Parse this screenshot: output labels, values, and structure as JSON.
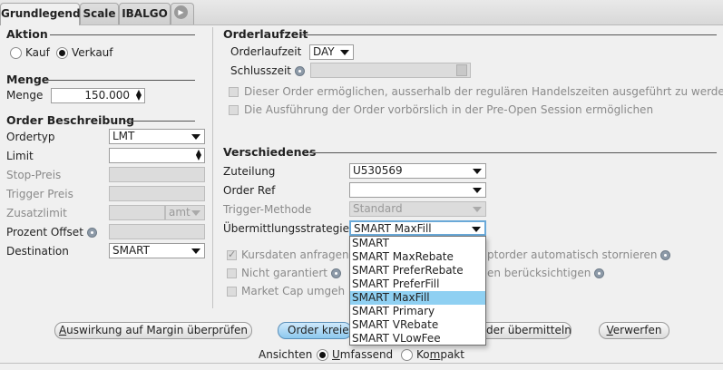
{
  "tabs": [
    {
      "label": "Grundlegend",
      "active": true
    },
    {
      "label": "Scale",
      "active": false
    },
    {
      "label": "IBALGO",
      "active": false
    }
  ],
  "tab_more_icon": "play-circle-icon",
  "aktion": {
    "title": "Aktion",
    "kauf_label": "Kauf",
    "verkauf_label": "Verkauf",
    "selected": "Verkauf"
  },
  "menge": {
    "title": "Menge",
    "label": "Menge",
    "value": "150.000"
  },
  "order_beschreibung": {
    "title": "Order Beschreibung",
    "ordertyp_label": "Ordertyp",
    "ordertyp_value": "LMT",
    "limit_label": "Limit",
    "limit_value": "",
    "stop_label": "Stop-Preis",
    "trigger_label": "Trigger Preis",
    "zusatzlimit_label": "Zusatzlimit",
    "zusatzlimit_unit": "amt",
    "prozent_label": "Prozent Offset",
    "destination_label": "Destination",
    "destination_value": "SMART"
  },
  "orderlaufzeit": {
    "title": "Orderlaufzeit",
    "laufzeit_label": "Orderlaufzeit",
    "laufzeit_value": "DAY",
    "schlusszeit_label": "Schlusszeit",
    "schlusszeit_value": "",
    "check1": "Dieser Order ermöglichen, ausserhalb der regulären Handelszeiten ausgeführt zu werden",
    "check2": "Die Ausführung der Order vorbörslich in der Pre-Open Session ermöglichen"
  },
  "verschiedenes": {
    "title": "Verschiedenes",
    "zuteilung_label": "Zuteilung",
    "zuteilung_value": "U530569",
    "orderref_label": "Order Ref",
    "orderref_value": "",
    "trigger_methode_label": "Trigger-Methode",
    "trigger_methode_value": "Standard",
    "strategie_label": "Übermittlungsstrategie",
    "strategie_value": "SMART MaxFill",
    "kursdaten_label": "Kursdaten anfragen",
    "kursdaten_right": "ptorder automatisch stornieren",
    "nicht_garantiert_label": "Nicht garantiert",
    "nicht_garantiert_right": "en berücksichtigen",
    "market_cap_label": "Market Cap umgeh"
  },
  "strategie_options": [
    "SMART",
    "SMART MaxRebate",
    "SMART PreferRebate",
    "SMART PreferFill",
    "SMART MaxFill",
    "SMART Primary",
    "SMART VRebate",
    "SMART VLowFee"
  ],
  "strategie_selected_index": 4,
  "buttons": {
    "margin": "Auswirkung auf Margin überprüfen",
    "margin_ul": "A",
    "margin_rest": "uswirkung auf Margin überprüfen",
    "order_kreieren": "Order kreie",
    "order_uebermitteln": "der übermitteln",
    "verwerfen": "Verwerfen",
    "verwerfen_ul": "V",
    "verwerfen_rest": "erwerfen"
  },
  "ansichten": {
    "label": "Ansichten",
    "umfassend_ul": "U",
    "umfassend_rest": "mfassend",
    "kompakt_a": "Ko",
    "kompakt_ul": "m",
    "kompakt_b": "pakt",
    "selected": "Umfassend"
  },
  "colors": {
    "highlight": "#8fd0f2",
    "button_focus": "#8cc8ee"
  }
}
